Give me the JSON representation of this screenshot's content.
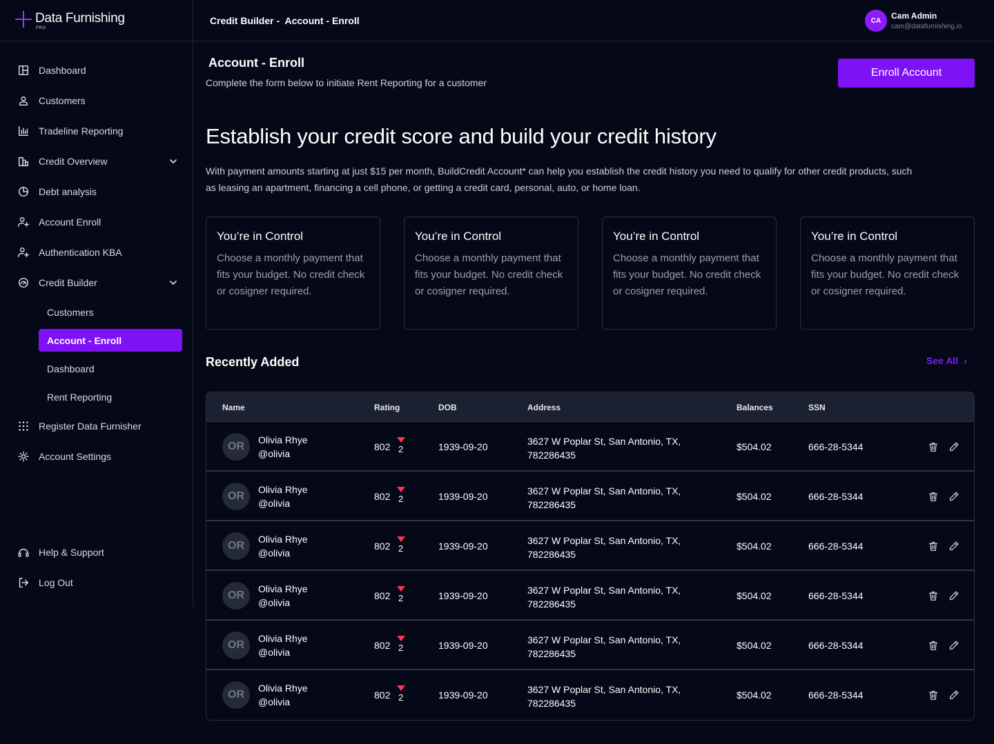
{
  "brand": {
    "name": "Data Furnishing",
    "tier": "PRO",
    "accent": "#7f11f5"
  },
  "header": {
    "breadcrumb": [
      "Credit Builder -",
      "Account - Enroll"
    ],
    "user": {
      "initials": "CA",
      "name": "Cam Admin",
      "email": "cam@datafurnishing.io"
    }
  },
  "sidebar": {
    "items": [
      {
        "label": "Dashboard",
        "icon": "layout-icon"
      },
      {
        "label": "Customers",
        "icon": "user-icon"
      },
      {
        "label": "Tradeline Reporting",
        "icon": "bar-chart-icon"
      },
      {
        "label": "Credit Overview",
        "icon": "building-chart-icon"
      },
      {
        "label": "Debt analysis",
        "icon": "pie-chart-icon"
      },
      {
        "label": "Account Enroll",
        "icon": "user-plus-icon"
      },
      {
        "label": "Authentication KBA",
        "icon": "user-plus-icon"
      },
      {
        "label": "Credit Builder",
        "icon": "gauge-icon"
      },
      {
        "label": "Register Data Furnisher",
        "icon": "dots-grid-icon"
      },
      {
        "label": "Account Settings",
        "icon": "gear-icon"
      }
    ],
    "sub_items": [
      {
        "label": "Customers"
      },
      {
        "label": "Account - Enroll"
      },
      {
        "label": "Dashboard"
      },
      {
        "label": "Rent Reporting"
      }
    ],
    "footer": [
      {
        "label": "Help & Support",
        "icon": "headset-icon"
      },
      {
        "label": "Log Out",
        "icon": "logout-icon"
      }
    ]
  },
  "main": {
    "title": "Account - Enroll",
    "subtitle": "Complete the form below to initiate Rent Reporting for a customer",
    "enroll_button": "Enroll Account",
    "hero_title": "Establish your credit score and build your credit history",
    "hero_description": "With payment amounts starting at just $15 per month, BuildCredit Account* can help you establish the credit history you need to qualify for other credit products, such as leasing an apartment, financing a cell phone, or getting a credit card, personal, auto, or home loan.",
    "cards": [
      {
        "title": "You’re in Control",
        "body": "Choose a monthly payment that fits your budget. No credit check or cosigner required."
      },
      {
        "title": "You’re in Control",
        "body": "Choose a monthly payment that fits your budget. No credit check or cosigner required."
      },
      {
        "title": "You’re in Control",
        "body": "Choose a monthly payment that fits your budget. No credit check or cosigner required."
      },
      {
        "title": "You’re in Control",
        "body": "Choose a monthly payment that fits your budget. No credit check or cosigner required."
      }
    ],
    "recent": {
      "title": "Recently Added",
      "see_all": "See All",
      "columns": [
        "Name",
        "Rating",
        "DOB",
        "Address",
        "Balances",
        "SSN"
      ],
      "rows": [
        {
          "initials": "OR",
          "name": "Olivia Rhye",
          "handle": "@olivia",
          "rating": "802",
          "delta": "2",
          "dob": "1939-09-20",
          "address": "3627 W Poplar St, San Antonio, TX, 782286435",
          "balance": "$504.02",
          "ssn": "666-28-5344"
        },
        {
          "initials": "OR",
          "name": "Olivia Rhye",
          "handle": "@olivia",
          "rating": "802",
          "delta": "2",
          "dob": "1939-09-20",
          "address": "3627 W Poplar St, San Antonio, TX, 782286435",
          "balance": "$504.02",
          "ssn": "666-28-5344"
        },
        {
          "initials": "OR",
          "name": "Olivia Rhye",
          "handle": "@olivia",
          "rating": "802",
          "delta": "2",
          "dob": "1939-09-20",
          "address": "3627 W Poplar St, San Antonio, TX, 782286435",
          "balance": "$504.02",
          "ssn": "666-28-5344"
        },
        {
          "initials": "OR",
          "name": "Olivia Rhye",
          "handle": "@olivia",
          "rating": "802",
          "delta": "2",
          "dob": "1939-09-20",
          "address": "3627 W Poplar St, San Antonio, TX, 782286435",
          "balance": "$504.02",
          "ssn": "666-28-5344"
        },
        {
          "initials": "OR",
          "name": "Olivia Rhye",
          "handle": "@olivia",
          "rating": "802",
          "delta": "2",
          "dob": "1939-09-20",
          "address": "3627 W Poplar St, San Antonio, TX, 782286435",
          "balance": "$504.02",
          "ssn": "666-28-5344"
        },
        {
          "initials": "OR",
          "name": "Olivia Rhye",
          "handle": "@olivia",
          "rating": "802",
          "delta": "2",
          "dob": "1939-09-20",
          "address": "3627 W Poplar St, San Antonio, TX, 782286435",
          "balance": "$504.02",
          "ssn": "666-28-5344"
        }
      ]
    }
  }
}
